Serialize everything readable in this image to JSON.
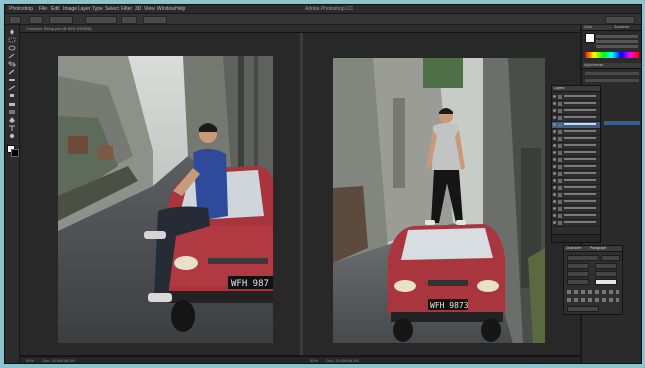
{
  "app": {
    "menu": [
      "Photoshop",
      "File",
      "Edit",
      "Image",
      "Layer",
      "Type",
      "Select",
      "Filter",
      "3D",
      "View",
      "Window",
      "Help"
    ],
    "window_title": "Adobe Photoshop CC"
  },
  "document": {
    "tab_label": "Compare Setup.psd @ 50% (RGB/8)",
    "zoom_left": "50%",
    "zoom_right": "50%",
    "doc_info_left": "Doc: 24.0M/48.2M",
    "doc_info_right": "Doc: 24.0M/48.2M"
  },
  "photos": {
    "left_plate": "WFH 987",
    "right_plate": "WFH 9873"
  },
  "panels": {
    "color_tab": "Color",
    "swatches_tab": "Swatches",
    "adjustments_tab": "Adjustments",
    "layers_tab": "Layers",
    "character_tab": "Character",
    "paragraph_tab": "Paragraph"
  },
  "colors": {
    "accent": "#3a5f8d",
    "ui_dark": "#1f1f1f",
    "background": "#8cc4d2"
  }
}
